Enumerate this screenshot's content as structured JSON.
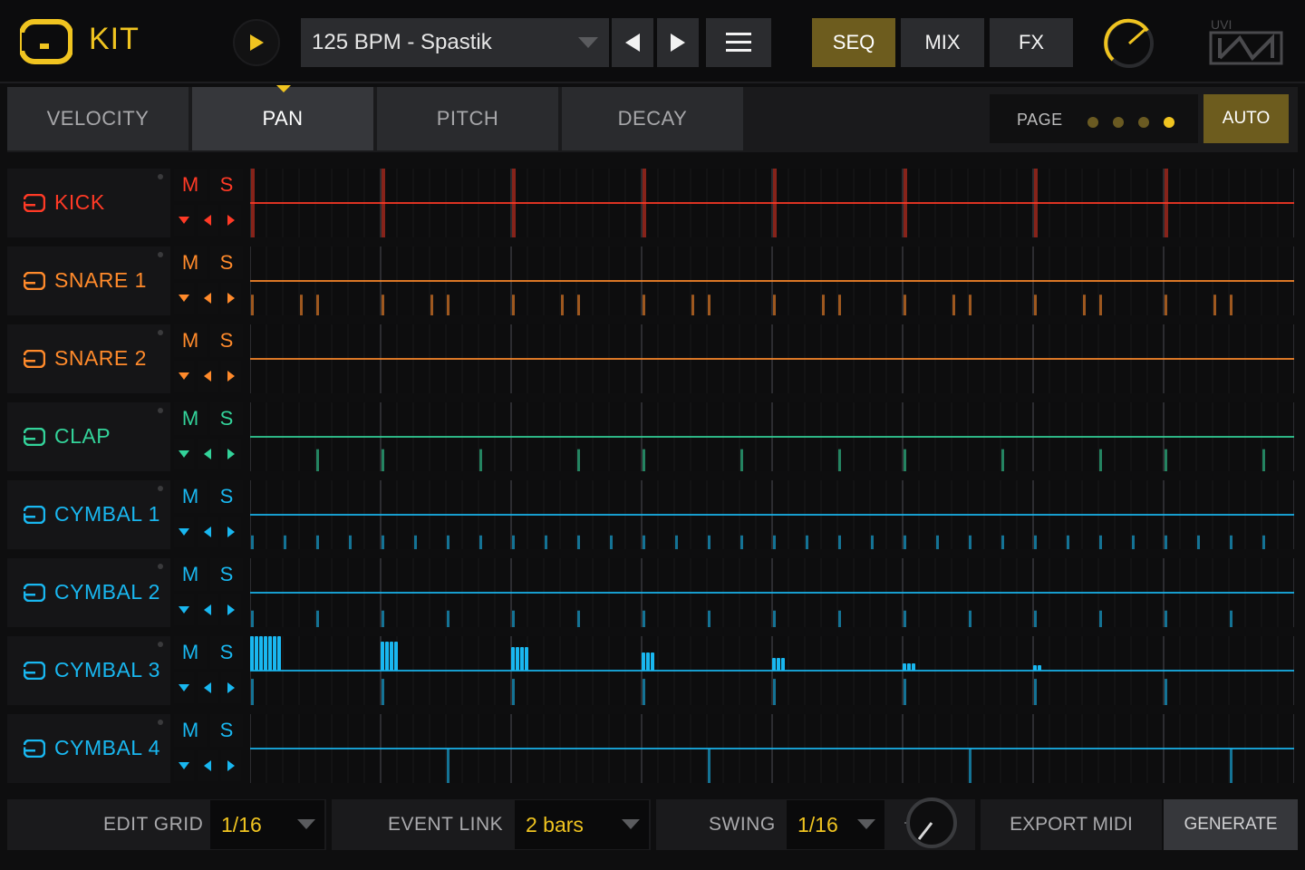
{
  "header": {
    "title": "KIT",
    "preset": "125 BPM - Spastik",
    "tabs": {
      "seq": "SEQ",
      "mix": "MIX",
      "fx": "FX"
    },
    "brand": "UVI",
    "accent": "#f0c420"
  },
  "param_tabs": [
    "VELOCITY",
    "PAN",
    "PITCH",
    "DECAY"
  ],
  "active_param_tab": "PAN",
  "page": {
    "label": "PAGE",
    "count": 4,
    "active": 4,
    "auto_label": "AUTO"
  },
  "tracks": [
    {
      "name": "KICK",
      "color": "#ff3a26",
      "mute": "M",
      "solo": "S"
    },
    {
      "name": "SNARE 1",
      "color": "#ff8a2b",
      "mute": "M",
      "solo": "S"
    },
    {
      "name": "SNARE 2",
      "color": "#ff8a2b",
      "mute": "M",
      "solo": "S"
    },
    {
      "name": "CLAP",
      "color": "#33d39a",
      "mute": "M",
      "solo": "S"
    },
    {
      "name": "CYMBAL 1",
      "color": "#19b7f0",
      "mute": "M",
      "solo": "S"
    },
    {
      "name": "CYMBAL 2",
      "color": "#19b7f0",
      "mute": "M",
      "solo": "S"
    },
    {
      "name": "CYMBAL 3",
      "color": "#19b7f0",
      "mute": "M",
      "solo": "S"
    },
    {
      "name": "CYMBAL 4",
      "color": "#19b7f0",
      "mute": "M",
      "solo": "S"
    }
  ],
  "footer": {
    "edit_grid_label": "EDIT GRID",
    "edit_grid_value": "1/16",
    "event_link_label": "EVENT LINK",
    "event_link_value": "2 bars",
    "swing_label": "SWING",
    "swing_value": "1/16",
    "export_label": "EXPORT MIDI",
    "generate_label": "GENERATE"
  }
}
